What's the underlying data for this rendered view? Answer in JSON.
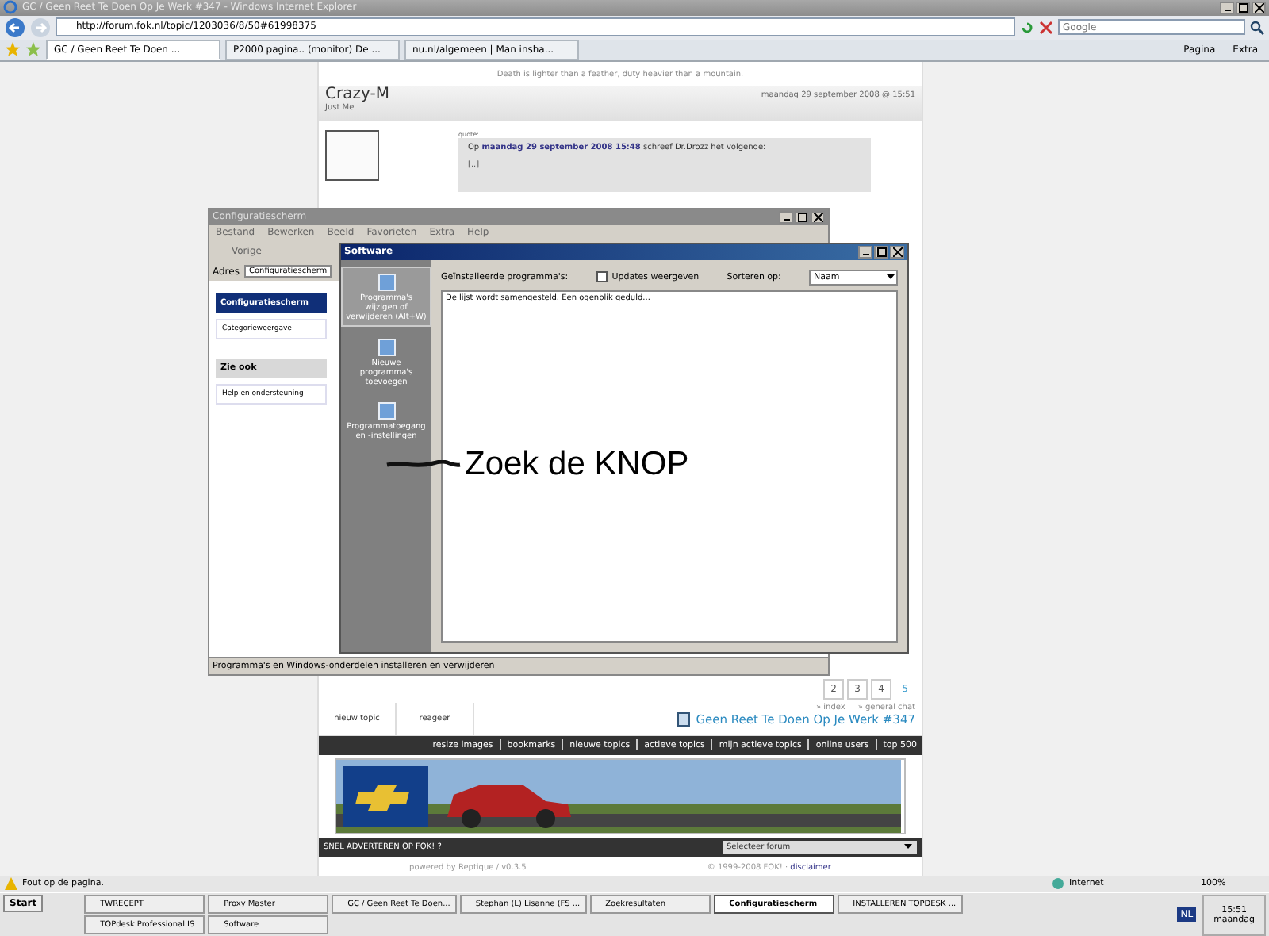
{
  "browser": {
    "title": "GC / Geen Reet Te Doen Op Je Werk #347 - Windows Internet Explorer",
    "address": "http://forum.fok.nl/topic/1203036/8/50#61998375",
    "search": {
      "placeholder": "Google"
    },
    "tabs": [
      {
        "label": "GC / Geen Reet Te Doen ...",
        "selected": true
      },
      {
        "label": "P2000 pagina.. (monitor) De ...",
        "selected": false
      },
      {
        "label": "nu.nl/algemeen | Man insha...",
        "selected": false
      }
    ],
    "commands": [
      "Pagina",
      "Extra"
    ]
  },
  "forum": {
    "signature": "Death is lighter than a feather, duty heavier than a mountain.",
    "post": {
      "author": "Crazy-M",
      "subtitle": "Just Me",
      "date": "maandag 29 september 2008 @ 15:51",
      "quote_label": "quote:",
      "quote_header": "Op **maandag 29 september 2008 15:48** schreef Dr.Drozz het volgende:",
      "quote_body": "[..]"
    },
    "pages": [
      {
        "label": "2",
        "selected": false
      },
      {
        "label": "3",
        "selected": false
      },
      {
        "label": "4",
        "selected": false
      },
      {
        "label": "5",
        "selected": true
      }
    ],
    "actions": [
      "nieuw topic",
      "reageer"
    ],
    "links": [
      "» index",
      "» general chat"
    ],
    "topic_title": "Geen Reet Te Doen Op Je Werk #347",
    "nav": [
      "resize images",
      "bookmarks",
      "nieuwe topics",
      "actieve topics",
      "mijn actieve topics",
      "online users",
      "top 500"
    ],
    "ad_bar": "SNEL ADVERTEREN OP FOK! ?",
    "forum_select": {
      "value": "Selecteer forum"
    },
    "footer_left": "powered by Reptique / v0.3.5",
    "footer_right": "© 1999-2008 FOK! ·",
    "footer_link": "disclaimer"
  },
  "control_panel": {
    "title": "Configuratiescherm",
    "menu": [
      "Bestand",
      "Bewerken",
      "Beeld",
      "Favorieten",
      "Extra",
      "Help"
    ],
    "back": "Vorige",
    "address_label": "Adres",
    "address": "Configuratiescherm",
    "panel_title": "Configuratiescherm",
    "view_switch": "Categorieweergave",
    "see_also": "Zie ook",
    "help": "Help en ondersteuning",
    "status": "Programma's en Windows-onderdelen installeren en verwijderen"
  },
  "software": {
    "title": "Software",
    "tasks": [
      {
        "label": "Programma's wijzigen of verwijderen (Alt+W)",
        "selected": true
      },
      {
        "label": "Nieuwe programma's toevoegen",
        "selected": false
      },
      {
        "label": "Programmatoegang en -instellingen",
        "selected": false
      }
    ],
    "installed_label": "Geïnstalleerde programma's:",
    "updates": {
      "label": "Updates weergeven",
      "checked": false
    },
    "sort_label": "Sorteren op:",
    "sort_value": "Naam",
    "list_message": "De lijst wordt samengesteld. Een ogenblik geduld..."
  },
  "annotation": "Zoek de KNOP",
  "status_bar": {
    "message": "Fout op de pagina.",
    "zone": "Internet",
    "zoom": "100%"
  },
  "taskbar": {
    "start": "Start",
    "buttons_top": [
      {
        "label": "TWRECEPT",
        "selected": false
      },
      {
        "label": "Proxy Master",
        "selected": false
      },
      {
        "label": "GC / Geen Reet Te Doen...",
        "selected": false
      },
      {
        "label": "Stephan (L) Lisanne (FS ...",
        "selected": false
      },
      {
        "label": "Zoekresultaten",
        "selected": false
      },
      {
        "label": "Configuratiescherm",
        "selected": true
      },
      {
        "label": "INSTALLEREN TOPDESK ...",
        "selected": false
      }
    ],
    "buttons_bottom": [
      {
        "label": "TOPdesk Professional IS",
        "selected": false
      },
      {
        "label": "Software",
        "selected": false
      }
    ],
    "language": "NL",
    "time": "15:51",
    "day": "maandag"
  }
}
